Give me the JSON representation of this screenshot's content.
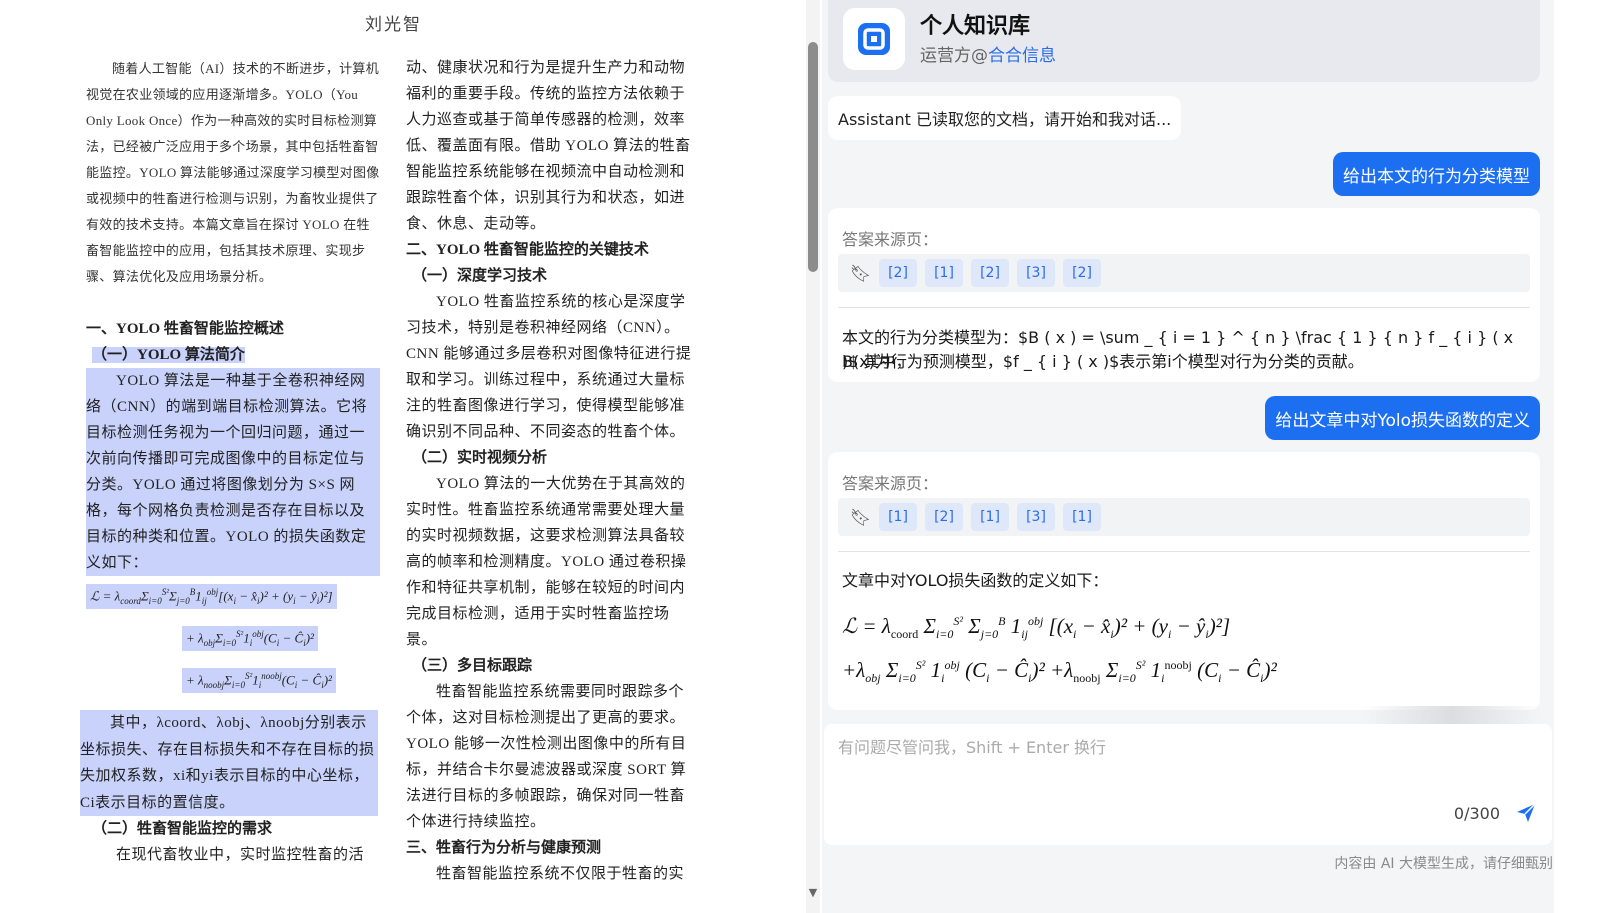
{
  "document": {
    "author": "刘光智",
    "left_intro": "随着人工智能（AI）技术的不断进步，计算机视觉在农业领域的应用逐渐增多。YOLO（You Only Look Once）作为一种高效的实时目标检测算法，已经被广泛应用于多个场景，其中包括牲畜智能监控。YOLO 算法能够通过深度学习模型对图像或视频中的牲畜进行检测与识别，为畜牧业提供了有效的技术支持。本篇文章旨在探讨 YOLO 在牲畜智能监控中的应用，包括其技术原理、实现步骤、算法优化及应用场景分析。",
    "h_overview": "一、YOLO 牲畜智能监控概述",
    "h_yolo_intro": "（一）YOLO 算法简介",
    "p_yolo_intro": "YOLO 算法是一种基于全卷积神经网络（CNN）的端到端目标检测算法。它将目标检测任务视为一个回归问题，通过一次前向传播即可完成图像中的目标定位与分类。YOLO 通过将图像划分为 S×S 网格，每个网格负责检测是否存在目标以及目标的种类和位置。YOLO 的损失函数定义如下：",
    "p_weights": "其中，λcoord、λobj、λnoobj分别表示坐标损失、存在目标损失和不存在目标的损失加权系数，xi和yi表示目标的中心坐标，Ci表示目标的置信度。",
    "h_needs": "（二）牲畜智能监控的需求",
    "p_needs": "在现代畜牧业中，实时监控牲畜的活",
    "right_p1": "动、健康状况和行为是提升生产力和动物福利的重要手段。传统的监控方法依赖于人力巡查或基于简单传感器的检测，效率低、覆盖面有限。借助 YOLO 算法的牲畜智能监控系统能够在视频流中自动检测和跟踪牲畜个体，识别其行为和状态，如进食、休息、走动等。",
    "h_key_tech": "二、YOLO 牲畜智能监控的关键技术",
    "h_deep": "（一）深度学习技术",
    "p_deep": "YOLO 牲畜监控系统的核心是深度学习技术，特别是卷积神经网络（CNN）。CNN 能够通过多层卷积对图像特征进行提取和学习。训练过程中，系统通过大量标注的牲畜图像进行学习，使得模型能够准确识别不同品种、不同姿态的牲畜个体。",
    "h_realtime": "（二）实时视频分析",
    "p_realtime": "YOLO 算法的一大优势在于其高效的实时性。牲畜监控系统通常需要处理大量的实时视频数据，这要求检测算法具备较高的帧率和检测精度。YOLO 通过卷积操作和特征共享机制，能够在较短的时间内完成目标检测，适用于实时牲畜监控场景。",
    "h_tracking": "（三）多目标跟踪",
    "p_tracking": "牲畜智能监控系统需要同时跟踪多个个体，这对目标检测提出了更高的要求。YOLO 能够一次性检测出图像中的所有目标，并结合卡尔曼滤波器或深度 SORT 算法进行目标的多帧跟踪，确保对同一牲畜个体进行持续监控。",
    "h_behavior": "三、牲畜行为分析与健康预测",
    "p_behavior": "牲畜智能监控系统不仅限于牲畜的实"
  },
  "chat": {
    "app_title": "个人知识库",
    "operator_prefix": "运营方@",
    "operator_name": "合合信息",
    "greeting": "Assistant 已读取您的文档，请开始和我对话...",
    "messages": [
      {
        "question": "给出本文的行为分类模型",
        "sources_label": "答案来源页：",
        "sources": [
          "[2]",
          "[1]",
          "[2]",
          "[3]",
          "[2]"
        ],
        "answer_line1": "本文的行为分类模型为：$B ( x ) = \\sum _ { i = 1 } ^ { n } \\frac { 1 } { n } f _ { i } ( x )$ 其中，",
        "answer_line2": "B(x)为行为预测模型，$f _ { i } ( x )$表示第i个模型对行为分类的贡献。"
      },
      {
        "question": "给出文章中对Yolo损失函数的定义",
        "sources_label": "答案来源页：",
        "sources": [
          "[1]",
          "[2]",
          "[1]",
          "[3]",
          "[1]"
        ],
        "answer_intro": "文章中对YOLO损失函数的定义如下："
      }
    ],
    "composer": {
      "placeholder": "有问题尽管问我，Shift + Enter 换行",
      "value": "",
      "char_count": "0/300"
    },
    "disclaimer": "内容由 AI 大模型生成，请仔细甄别"
  },
  "colors": {
    "accent": "#1d6ff2",
    "highlight": "#c8d2fb",
    "chip_bg": "#dfe8fa",
    "link": "#2a6ce8"
  }
}
